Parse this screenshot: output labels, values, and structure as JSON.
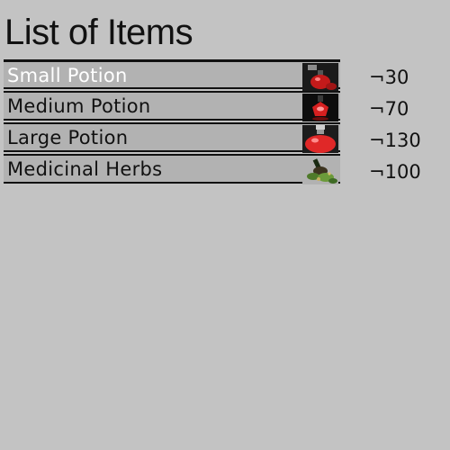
{
  "title": "List of Items",
  "items": [
    {
      "name": "Small Potion",
      "price": "¬30",
      "icon": "small-potion-icon",
      "selected": true
    },
    {
      "name": "Medium Potion",
      "price": "¬70",
      "icon": "medium-potion-icon",
      "selected": false
    },
    {
      "name": "Large Potion",
      "price": "¬130",
      "icon": "large-potion-icon",
      "selected": false
    },
    {
      "name": "Medicinal Herbs",
      "price": "¬100",
      "icon": "medicinal-herbs-icon",
      "selected": false
    }
  ],
  "colors": {
    "background": "#c3c3c3",
    "row_fill": "#b2b2b2",
    "selected_text": "#ffffff",
    "potion_red": "#d62020"
  }
}
